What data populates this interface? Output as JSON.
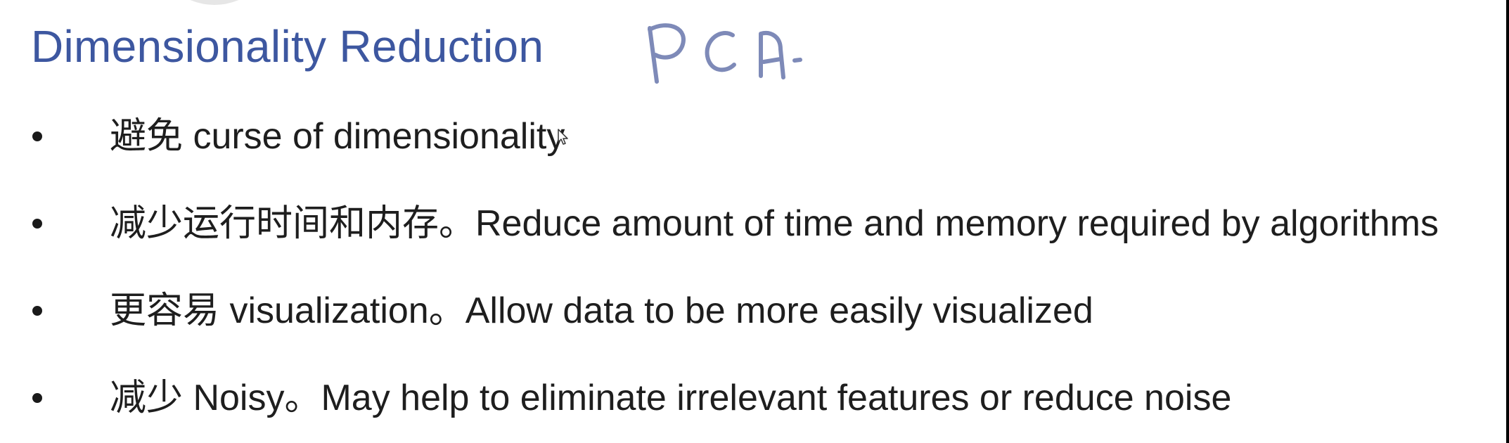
{
  "slide": {
    "title": "Dimensionality Reduction",
    "annotation_text": "PCA.",
    "title_color": "#3d57a0",
    "annotation_color": "#7e8ab8",
    "bullets": [
      {
        "text": "避免 curse of dimensionality"
      },
      {
        "text": "减少运行时间和内存。Reduce amount of time and memory required by algorithms"
      },
      {
        "text": "更容易 visualization。Allow data to be more easily visualized"
      },
      {
        "text": "减少 Noisy。May help to eliminate irrelevant features or reduce noise"
      }
    ]
  },
  "icons": {
    "cursor": "mouse-pointer-icon",
    "bullet": "bullet-dot-icon"
  }
}
